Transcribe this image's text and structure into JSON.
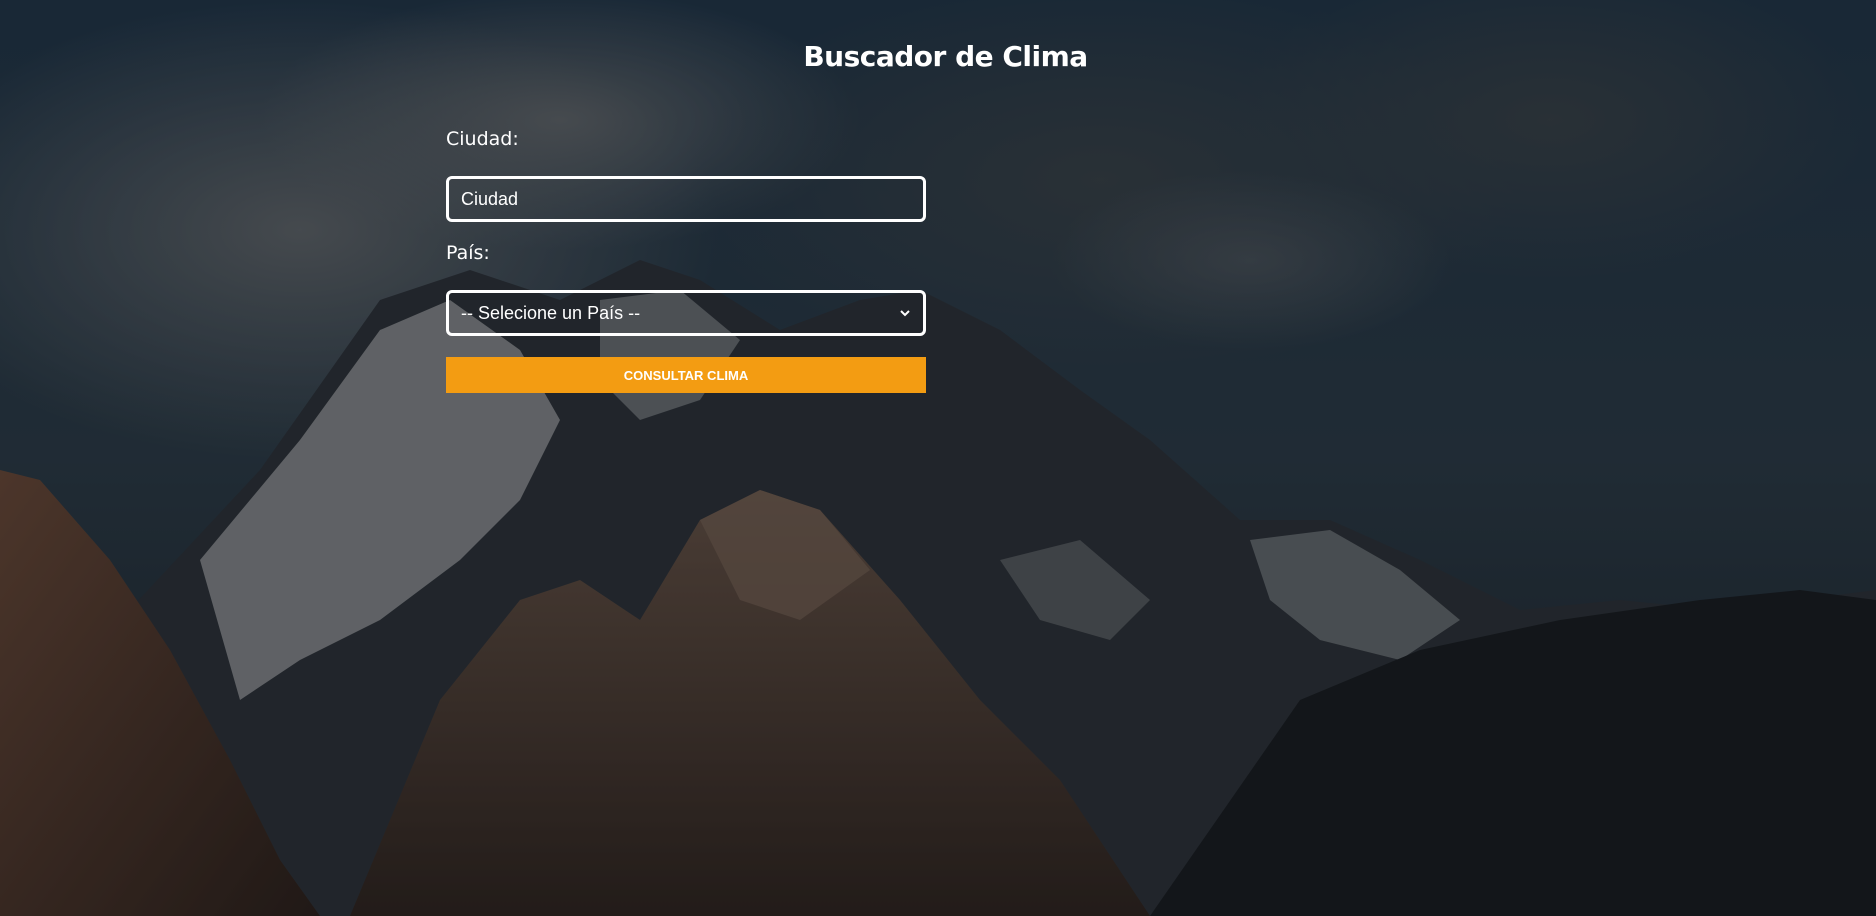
{
  "page": {
    "title": "Buscador de Clima"
  },
  "form": {
    "city_label": "Ciudad:",
    "city_placeholder": "Ciudad",
    "country_label": "País:",
    "country_selected": "-- Selecione un País --",
    "submit_label": "Consultar Clima"
  },
  "background": {
    "icon": "mountain-landscape-photo"
  },
  "colors": {
    "accent": "#f39c12",
    "text": "#ffffff"
  }
}
